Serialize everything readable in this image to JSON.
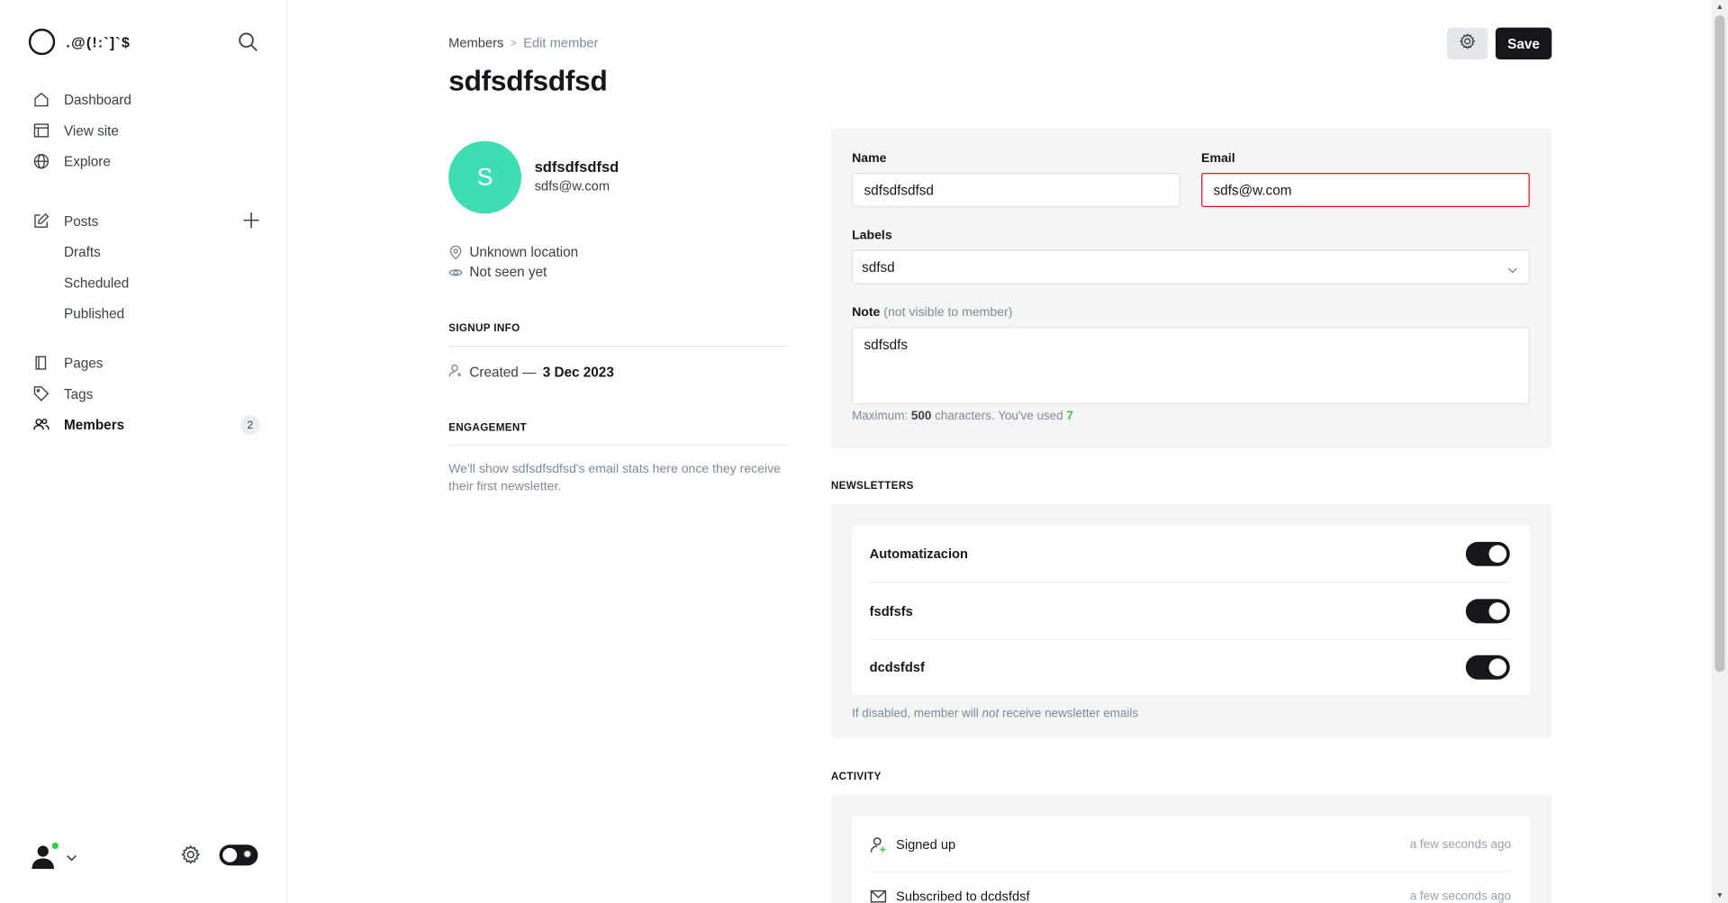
{
  "brand": {
    "name": ".@(!:`]`$"
  },
  "sidebar": {
    "items": [
      {
        "label": "Dashboard",
        "icon": "home-icon"
      },
      {
        "label": "View site",
        "icon": "layout-icon"
      },
      {
        "label": "Explore",
        "icon": "globe-icon"
      }
    ],
    "posts": {
      "label": "Posts",
      "icon": "edit-icon"
    },
    "post_subitems": [
      "Drafts",
      "Scheduled",
      "Published"
    ],
    "pages": {
      "label": "Pages",
      "icon": "book-icon"
    },
    "tags": {
      "label": "Tags",
      "icon": "tag-icon"
    },
    "members": {
      "label": "Members",
      "icon": "users-icon",
      "count": "2"
    }
  },
  "header": {
    "breadcrumb_parent": "Members",
    "breadcrumb_sep": ">",
    "breadcrumb_current": "Edit member",
    "title": "sdfsdfsdfsd",
    "save_label": "Save"
  },
  "profile": {
    "avatar_initial": "S",
    "name": "sdfsdfsdfsd",
    "email": "sdfs@w.com",
    "location": "Unknown location",
    "seen": "Not seen yet",
    "signup_heading": "SIGNUP INFO",
    "created_prefix": "Created —",
    "created_date": "3 Dec 2023",
    "engagement_heading": "ENGAGEMENT",
    "engagement_text": "We'll show sdfsdfsdfsd's email stats here once they receive their first newsletter."
  },
  "form": {
    "name_label": "Name",
    "name_value": "sdfsdfsdfsd",
    "email_label": "Email",
    "email_value": "sdfs@w.com",
    "labels_label": "Labels",
    "labels_value": "sdfsd",
    "note_label": "Note",
    "note_hint": "(not visible to member)",
    "note_value": "sdfsdfs",
    "counter_prefix": "Maximum: ",
    "counter_max": "500",
    "counter_mid": " characters. You've used ",
    "counter_used": "7"
  },
  "newsletters": {
    "heading": "NEWSLETTERS",
    "items": [
      {
        "name": "Automatizacion",
        "enabled": true
      },
      {
        "name": "fsdfsfs",
        "enabled": true
      },
      {
        "name": "dcdsfdsf",
        "enabled": true
      }
    ],
    "help_prefix": "If disabled, member will ",
    "help_em": "not",
    "help_suffix": " receive newsletter emails"
  },
  "activity": {
    "heading": "ACTIVITY",
    "items": [
      {
        "text": "Signed up",
        "time": "a few seconds ago",
        "icon": "user-add-icon"
      },
      {
        "text": "Subscribed to dcdsfdsf",
        "time": "a few seconds ago",
        "icon": "mail-icon"
      }
    ]
  },
  "colors": {
    "accent": "#15171a",
    "avatar": "#3eddb3",
    "error": "#f50b23",
    "online": "#30cf43"
  }
}
